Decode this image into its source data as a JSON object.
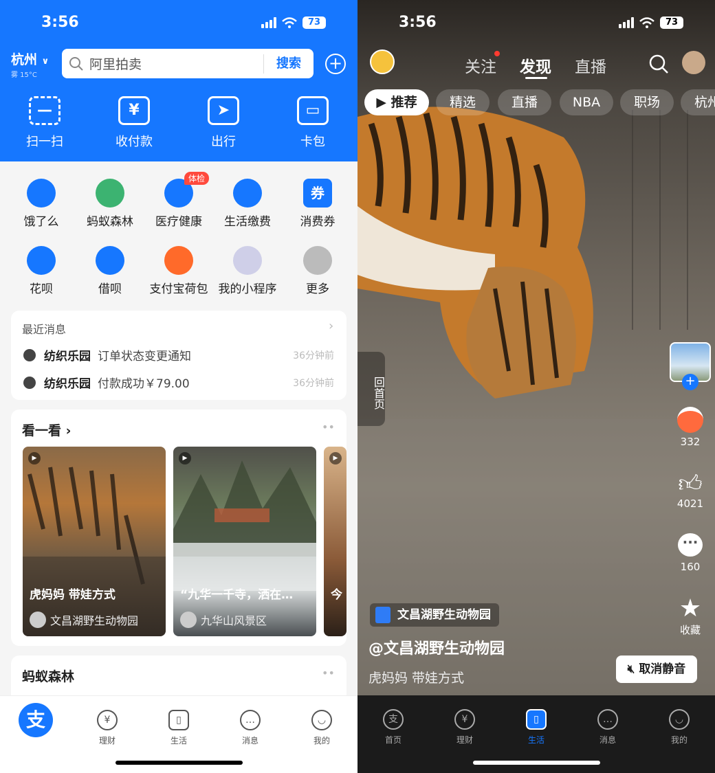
{
  "status": {
    "time": "3:56",
    "battery": "73"
  },
  "left": {
    "city": "杭州",
    "weather": "雾 15°C",
    "search_placeholder": "阿里拍卖",
    "search_button": "搜索",
    "quick_actions": [
      "扫一扫",
      "收付款",
      "出行",
      "卡包"
    ],
    "apps": [
      {
        "label": "饿了么",
        "color": "#1677ff",
        "icon": "eleme-icon"
      },
      {
        "label": "蚂蚁森林",
        "color": "#3cb371",
        "icon": "forest-icon"
      },
      {
        "label": "医疗健康",
        "color": "#1677ff",
        "icon": "heart-icon",
        "badge": "体检"
      },
      {
        "label": "生活缴费",
        "color": "#1677ff",
        "icon": "bolt-icon"
      },
      {
        "label": "消费券",
        "color": "#1677ff",
        "icon": "coupon-icon",
        "glyph": "券"
      },
      {
        "label": "花呗",
        "color": "#1677ff",
        "icon": "huabei-icon"
      },
      {
        "label": "借呗",
        "color": "#1677ff",
        "icon": "jiebei-icon"
      },
      {
        "label": "支付宝荷包",
        "color": "#ff6a2a",
        "icon": "wallet-icon"
      },
      {
        "label": "我的小程序",
        "color": "#cfcfe8",
        "icon": "miniapp-icon"
      },
      {
        "label": "更多",
        "color": "#bbbbbb",
        "icon": "more-icon"
      }
    ],
    "messages": {
      "title": "最近消息",
      "items": [
        {
          "source": "纺织乐园",
          "text": "订单状态变更通知",
          "time": "36分钟前"
        },
        {
          "source": "纺织乐园",
          "text": "付款成功￥79.00",
          "time": "36分钟前"
        }
      ]
    },
    "feed": {
      "title": "看一看",
      "cards": [
        {
          "caption": "虎妈妈 带娃方式",
          "author": "文昌湖野生动物园"
        },
        {
          "caption": "“九华一千寺，洒在…",
          "author": "九华山风景区"
        },
        {
          "caption": "今",
          "author": ""
        }
      ]
    },
    "forest_title": "蚂蚁森林",
    "tabs": [
      "理财",
      "生活",
      "消息",
      "我的"
    ]
  },
  "right": {
    "top_tabs": [
      "关注",
      "发现",
      "直播"
    ],
    "chips": [
      "推荐",
      "精选",
      "直播",
      "NBA",
      "职场",
      "杭州"
    ],
    "back_home": "回首页",
    "stats": {
      "gift": "332",
      "likes": "4021",
      "comments": "160",
      "favorite": "收藏"
    },
    "creator_tag": "文昌湖野生动物园",
    "handle": "@文昌湖野生动物园",
    "description": "虎妈妈 带娃方式",
    "unmute": "取消静音",
    "tabs": [
      "首页",
      "理财",
      "生活",
      "消息",
      "我的"
    ]
  },
  "colors": {
    "alipay_blue": "#1677ff",
    "badge_red": "#ff4a3d"
  }
}
